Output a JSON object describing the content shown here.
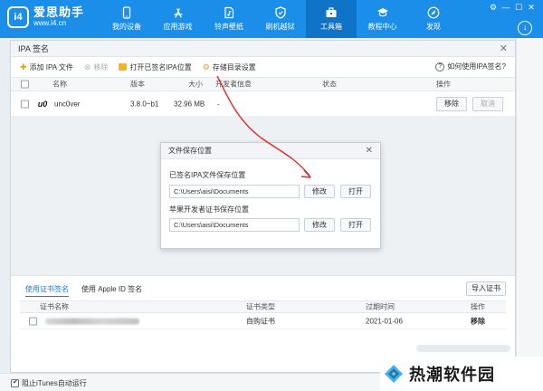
{
  "app": {
    "logo_mark": "i4",
    "name": "爱思助手",
    "url": "www.i4.cn",
    "window_controls": [
      "⚙",
      "—",
      "☐",
      "✕"
    ]
  },
  "nav": [
    {
      "label": "我的设备",
      "icon": "phone-icon"
    },
    {
      "label": "应用游戏",
      "icon": "app-store-icon"
    },
    {
      "label": "铃声壁纸",
      "icon": "music-file-icon"
    },
    {
      "label": "刷机越狱",
      "icon": "shield-icon"
    },
    {
      "label": "工具箱",
      "icon": "toolbox-icon",
      "active": true
    },
    {
      "label": "教程中心",
      "icon": "graduation-cap-icon"
    },
    {
      "label": "发现",
      "icon": "compass-icon"
    }
  ],
  "panel": {
    "title": "IPA 签名",
    "toolbar": {
      "add": "添加 IPA 文件",
      "remove": "移除",
      "open_signed": "打开已签名IPA位置",
      "storage": "存储目录设置",
      "help": "如何使用IPA签名?"
    },
    "columns": {
      "name": "名称",
      "version": "版本",
      "size": "大小",
      "developer": "开发者信息",
      "status": "状态",
      "action": "操作"
    },
    "rows": [
      {
        "icon_text": "u0",
        "name": "unc0ver",
        "version": "3.8.0~b1",
        "size": "32.96 MB",
        "developer": "-",
        "remove": "移除",
        "cancel": "取消"
      }
    ]
  },
  "cert": {
    "tab_cert": "使用证书签名",
    "tab_appleid": "使用 Apple ID 签名",
    "import": "导入证书",
    "columns": {
      "name": "证书名称",
      "type": "证书类型",
      "expiry": "过期时间",
      "action": "操作"
    },
    "rows": [
      {
        "type": "自购证书",
        "expiry": "2021-01-06",
        "action": "移除"
      }
    ]
  },
  "modal": {
    "title": "文件保存位置",
    "label1": "已签名IPA文件保存位置",
    "path1": "C:\\Users\\aisi\\Documents",
    "label2": "苹果开发者证书保存位置",
    "path2": "C:\\Users\\aisi\\Documents",
    "modify": "修改",
    "open": "打开"
  },
  "footer": {
    "checkbox_label": "阻止iTunes自动运行"
  },
  "watermark": {
    "text": "热潮软件园"
  },
  "colors": {
    "brand_blue": "#1a8ee8",
    "active_nav": "#0f74c8",
    "annotation_arrow": "#e8262a"
  }
}
